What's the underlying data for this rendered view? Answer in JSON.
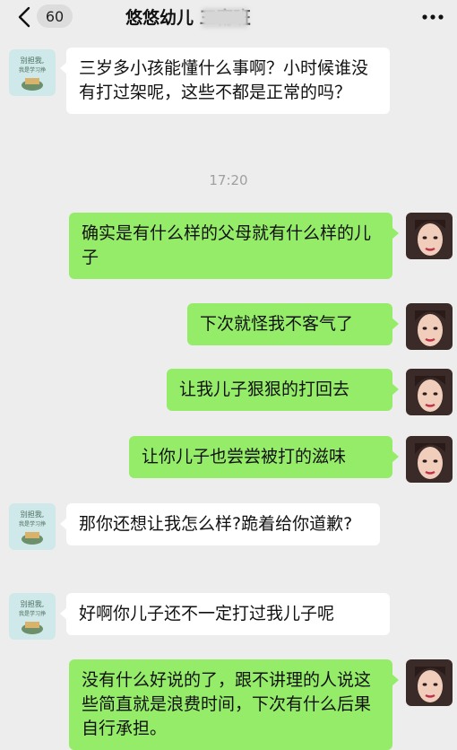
{
  "header": {
    "unread_count": "60",
    "title": "悠悠幼儿 三甯班"
  },
  "timestamp": "17:20",
  "messages": [
    {
      "side": "in",
      "text": "三岁多小孩能懂什么事啊？小时候谁没有打过架呢，这些不都是正常的吗？"
    },
    {
      "side": "out",
      "text": "确实是有什么样的父母就有什么样的儿子"
    },
    {
      "side": "out",
      "text": "下次就怪我不客气了"
    },
    {
      "side": "out",
      "text": "让我儿子狠狠的打回去"
    },
    {
      "side": "out",
      "text": "让你儿子也尝尝被打的滋味"
    },
    {
      "side": "in",
      "text": "那你还想让我怎么样?跪着给你道歉?"
    },
    {
      "side": "in",
      "text": "好啊你儿子还不一定打过我儿子呢"
    },
    {
      "side": "out",
      "text": "没有什么好说的了，跟不讲理的人说这些简直就是浪费时间，下次有什么后果自行承担。"
    }
  ],
  "avatars": {
    "in_caption_line1": "别担我,",
    "in_caption_line2": "我是学习挣"
  },
  "colors": {
    "background": "#ededed",
    "incoming_bubble": "#ffffff",
    "outgoing_bubble": "#95ec69"
  }
}
